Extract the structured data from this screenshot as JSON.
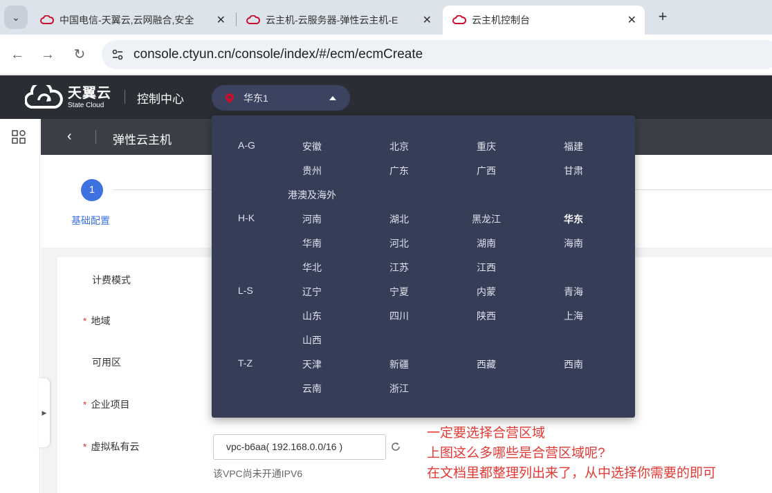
{
  "browser": {
    "tabs": [
      {
        "title": "中国电信-天翼云,云网融合,安全",
        "active": false
      },
      {
        "title": "云主机-云服务器-弹性云主机-E",
        "active": false
      },
      {
        "title": "云主机控制台",
        "active": true
      }
    ],
    "new_tab": "+",
    "url": "console.ctyun.cn/console/index/#/ecm/ecmCreate"
  },
  "header": {
    "logo_cn": "天翼云",
    "logo_en": "State Cloud",
    "console_title": "控制中心",
    "region_selected": "华东1"
  },
  "subheader": {
    "back": "‹",
    "title": "弹性云主机"
  },
  "steps": [
    {
      "number": "1",
      "label": "基础配置"
    }
  ],
  "form": {
    "billing_mode": "计费模式",
    "region": "地域",
    "availability_zone": "可用区",
    "enterprise_project": "企业项目",
    "vpc": "虚拟私有云",
    "vpc_value": "vpc-b6aa( 192.168.0.0/16 )",
    "vpc_hint": "该VPC尚未开通IPV6",
    "required_mark": "*"
  },
  "region_dropdown": {
    "groups": [
      {
        "label": "A-G",
        "regions": [
          "安徽",
          "北京",
          "重庆",
          "福建",
          "贵州",
          "广东",
          "广西",
          "甘肃",
          "港澳及海外"
        ]
      },
      {
        "label": "H-K",
        "regions": [
          "河南",
          "湖北",
          "黑龙江",
          "华东",
          "华南",
          "河北",
          "湖南",
          "海南",
          "华北",
          "江苏",
          "江西"
        ]
      },
      {
        "label": "L-S",
        "regions": [
          "辽宁",
          "宁夏",
          "内蒙",
          "青海",
          "山东",
          "四川",
          "陕西",
          "上海",
          "山西"
        ]
      },
      {
        "label": "T-Z",
        "regions": [
          "天津",
          "新疆",
          "西藏",
          "西南",
          "云南",
          "浙江"
        ]
      }
    ],
    "selected": "华东"
  },
  "annotation": {
    "lines": [
      "一定要选择合营区域",
      "上图这么多哪些是合营区域呢?",
      "在文档里都整理列出来了，从中选择你需要的即可"
    ],
    "color": "#e53935"
  },
  "colors": {
    "header_bg": "#2a2d33",
    "dropdown_bg": "#363d57",
    "accent_blue": "#3d72e0",
    "brand_red": "#c8102e"
  }
}
